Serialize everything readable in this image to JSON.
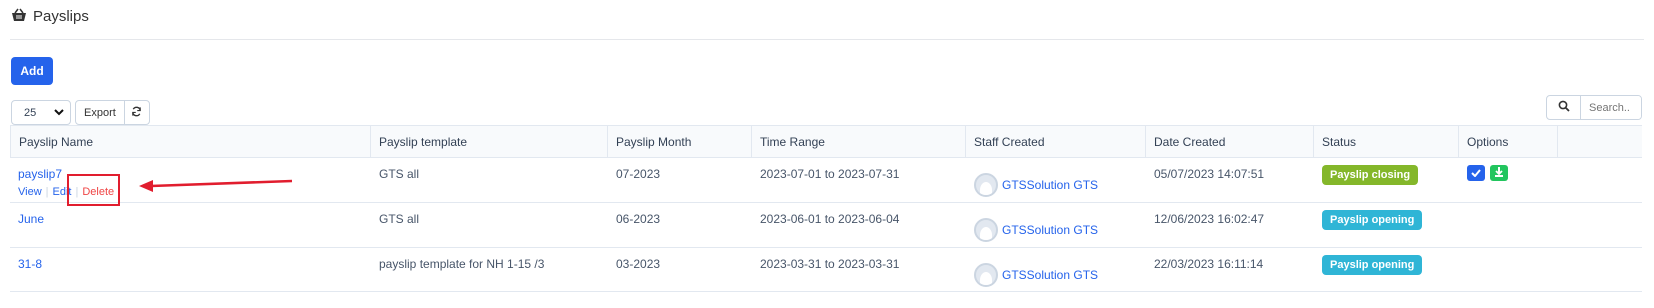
{
  "page": {
    "title": "Payslips",
    "icon": "basket-icon"
  },
  "toolbar": {
    "add_label": "Add",
    "page_length": "25",
    "export_label": "Export",
    "search_placeholder": "Search.."
  },
  "table": {
    "headers": [
      "Payslip Name",
      "Payslip template",
      "Payslip Month",
      "Time Range",
      "Staff Created",
      "Date Created",
      "Status",
      "Options"
    ],
    "row_actions": {
      "view": "View",
      "edit": "Edit",
      "delete": "Delete",
      "separator": "|"
    },
    "rows": [
      {
        "name": "payslip7",
        "template": "GTS all",
        "month": "07-2023",
        "range": "2023-07-01 to 2023-07-31",
        "staff": "GTSSolution GTS",
        "date": "05/07/2023 14:07:51",
        "status": "Payslip closing",
        "status_color": "#84b72a"
      },
      {
        "name": "June",
        "template": "GTS all",
        "month": "06-2023",
        "range": "2023-06-01 to 2023-06-04",
        "staff": "GTSSolution GTS",
        "date": "12/06/2023 16:02:47",
        "status": "Payslip opening",
        "status_color": "#2fb5d6"
      },
      {
        "name": "31-8",
        "template": "payslip template for NH 1-15 /3",
        "month": "03-2023",
        "range": "2023-03-31 to 2023-03-31",
        "staff": "GTSSolution GTS",
        "date": "22/03/2023 16:11:14",
        "status": "Payslip opening",
        "status_color": "#2fb5d6"
      }
    ]
  },
  "colors": {
    "primary": "#2563eb",
    "annotation": "#e11d2e",
    "success": "#22c55e"
  }
}
